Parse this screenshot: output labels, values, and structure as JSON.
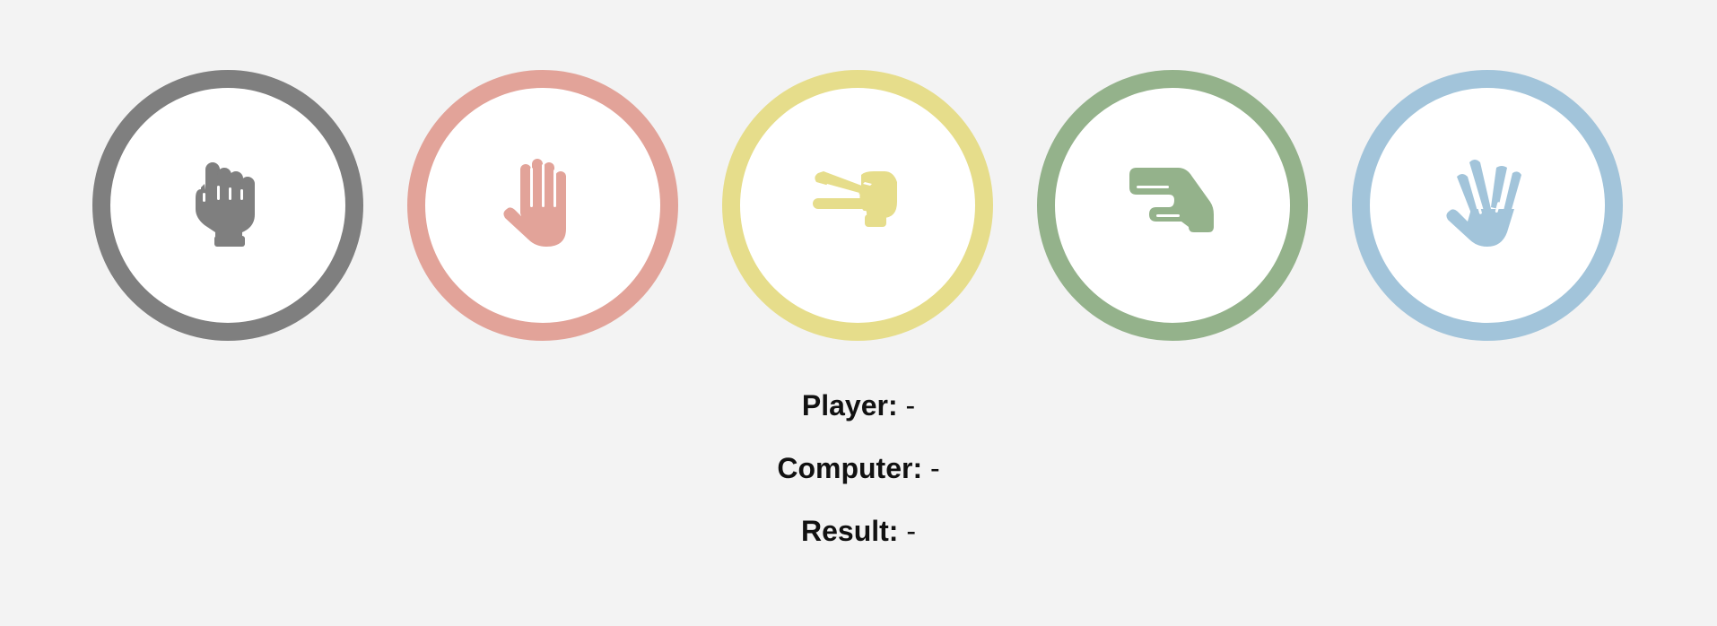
{
  "colors": {
    "rock": "#7f7f7f",
    "paper": "#e2a399",
    "scissors": "#e6dd8b",
    "lizard": "#94b28b",
    "spock": "#a2c4da",
    "background": "#f3f3f3",
    "circle_fill": "#ffffff"
  },
  "choices": [
    {
      "id": "rock",
      "icon": "hand-rock-icon"
    },
    {
      "id": "paper",
      "icon": "hand-paper-icon"
    },
    {
      "id": "scissors",
      "icon": "hand-scissors-icon"
    },
    {
      "id": "lizard",
      "icon": "hand-lizard-icon"
    },
    {
      "id": "spock",
      "icon": "hand-spock-icon"
    }
  ],
  "status": {
    "player_label": "Player:",
    "player_value": "-",
    "computer_label": "Computer:",
    "computer_value": "-",
    "result_label": "Result:",
    "result_value": "-"
  }
}
